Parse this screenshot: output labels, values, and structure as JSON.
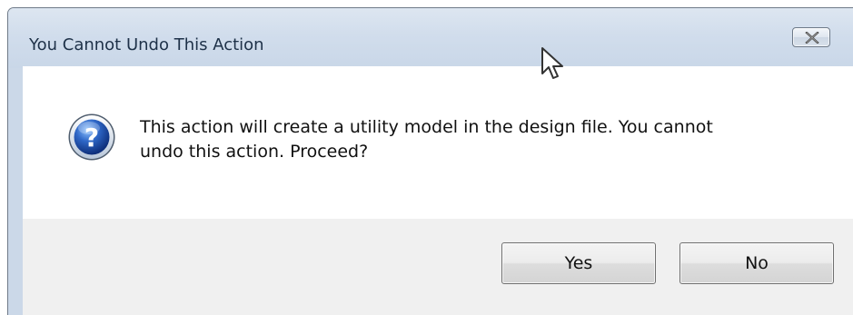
{
  "dialog": {
    "title": "You Cannot Undo This Action",
    "close_icon": "close-icon",
    "icon": "question-icon",
    "message_lines": [
      "This action will create a utility model in the design file. You cannot",
      "undo this action.  Proceed?"
    ],
    "buttons": {
      "yes_label": "Yes",
      "no_label": "No"
    }
  },
  "colors": {
    "titlebar": "#d1ddec",
    "content": "#ffffff",
    "footer": "#f0f0f0",
    "icon_blue": "#2f68c8"
  },
  "cursor": "arrow-cursor"
}
